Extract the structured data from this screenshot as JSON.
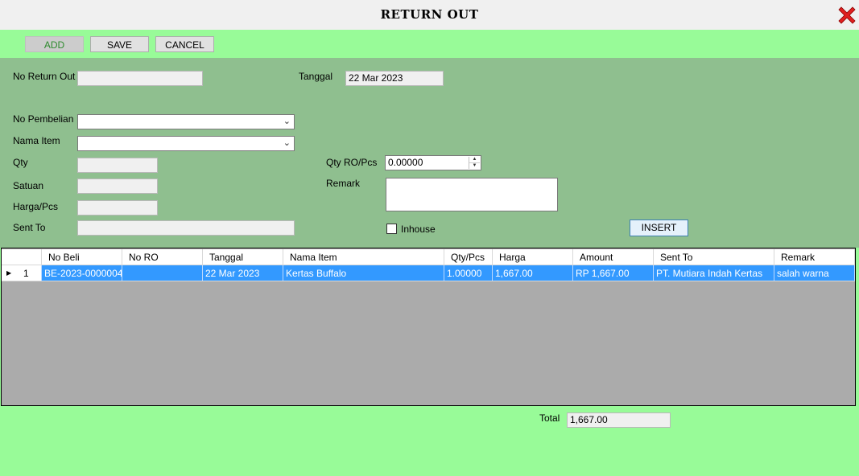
{
  "window": {
    "title": "RETURN OUT"
  },
  "toolbar": {
    "add_label": "ADD",
    "save_label": "SAVE",
    "cancel_label": "CANCEL"
  },
  "form": {
    "no_return_out_label": "No Return Out",
    "no_return_out_value": "",
    "tanggal_label": "Tanggal",
    "tanggal_value": "22 Mar 2023",
    "no_pembelian_label": "No Pembelian",
    "no_pembelian_value": "",
    "nama_item_label": "Nama Item",
    "nama_item_value": "",
    "qty_label": "Qty",
    "qty_value": "",
    "satuan_label": "Satuan",
    "satuan_value": "",
    "harga_pcs_label": "Harga/Pcs",
    "harga_pcs_value": "",
    "sent_to_label": "Sent To",
    "sent_to_value": "",
    "qty_ro_pcs_label": "Qty RO/Pcs",
    "qty_ro_pcs_value": "0.00000",
    "remark_label": "Remark",
    "remark_value": "",
    "inhouse_label": "Inhouse",
    "inhouse_checked": false,
    "insert_label": "INSERT"
  },
  "grid": {
    "columns": [
      "No Beli",
      "No RO",
      "Tanggal",
      "Nama Item",
      "Qty/Pcs",
      "Harga",
      "Amount",
      "Sent To",
      "Remark"
    ],
    "rows": [
      {
        "row_no": "1",
        "no_beli": "BE-2023-0000004",
        "no_ro": "",
        "tanggal": "22 Mar 2023",
        "nama_item": "Kertas Buffalo",
        "qty_pcs": "1.00000",
        "harga": "1,667.00",
        "amount": "RP 1,667.00",
        "sent_to": "PT. Mutiara Indah Kertas",
        "remark": "salah warna"
      }
    ]
  },
  "footer": {
    "total_label": "Total",
    "total_value": "1,667.00"
  },
  "colors": {
    "panel_green": "#98fb98",
    "form_green": "#8fbf8f",
    "selection_blue": "#3399ff",
    "close_red": "#e02020"
  }
}
